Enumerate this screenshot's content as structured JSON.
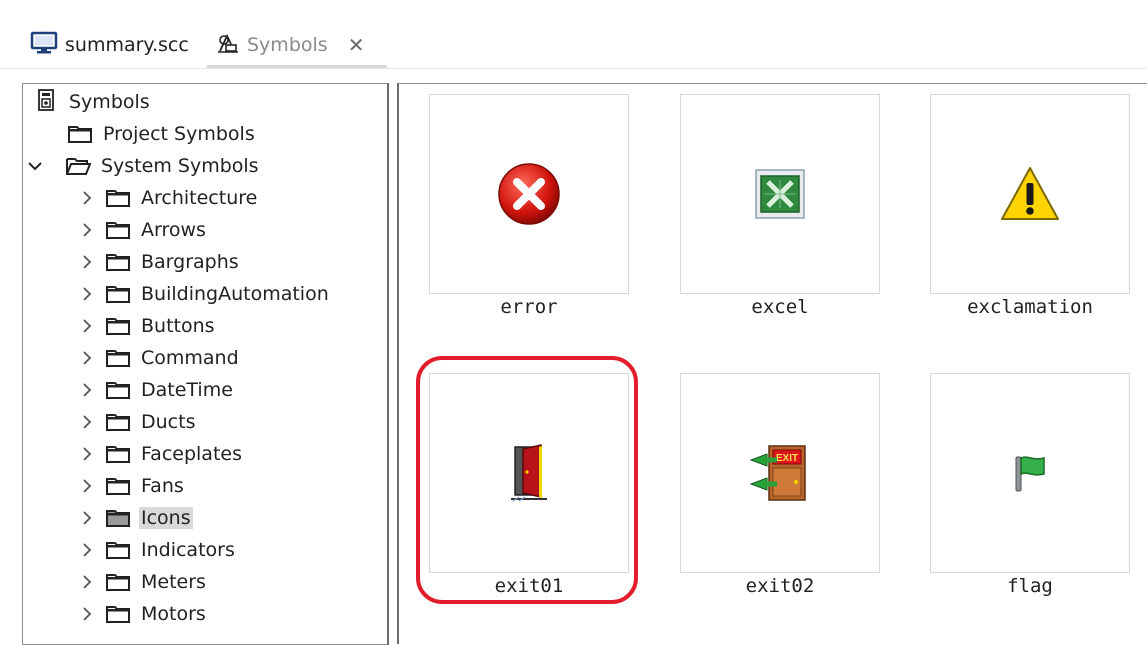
{
  "tabs": [
    {
      "label": "summary.scc",
      "icon": "monitor-icon"
    },
    {
      "label": "Symbols",
      "icon": "symbols-icon",
      "close": "✕"
    }
  ],
  "tree": {
    "root": {
      "label": "Symbols",
      "icon": "symbol-library-icon"
    },
    "project": {
      "label": "Project Symbols"
    },
    "system": {
      "label": "System Symbols",
      "expanded": true
    },
    "categories": [
      "Architecture",
      "Arrows",
      "Bargraphs",
      "BuildingAutomation",
      "Buttons",
      "Command",
      "DateTime",
      "Ducts",
      "Faceplates",
      "Fans",
      "Icons",
      "Indicators",
      "Meters",
      "Motors"
    ],
    "selected": "Icons"
  },
  "symbols": [
    {
      "label": "error",
      "icon": "error-icon"
    },
    {
      "label": "excel",
      "icon": "excel-icon"
    },
    {
      "label": "exclamation",
      "icon": "exclamation-icon"
    },
    {
      "label": "exit01",
      "icon": "door-exit-icon",
      "highlighted": true
    },
    {
      "label": "exit02",
      "icon": "exit-sign-icon"
    },
    {
      "label": "flag",
      "icon": "flag-icon"
    }
  ],
  "colors": {
    "highlight": "#e21c2a",
    "selection": "#d9d9d9"
  }
}
